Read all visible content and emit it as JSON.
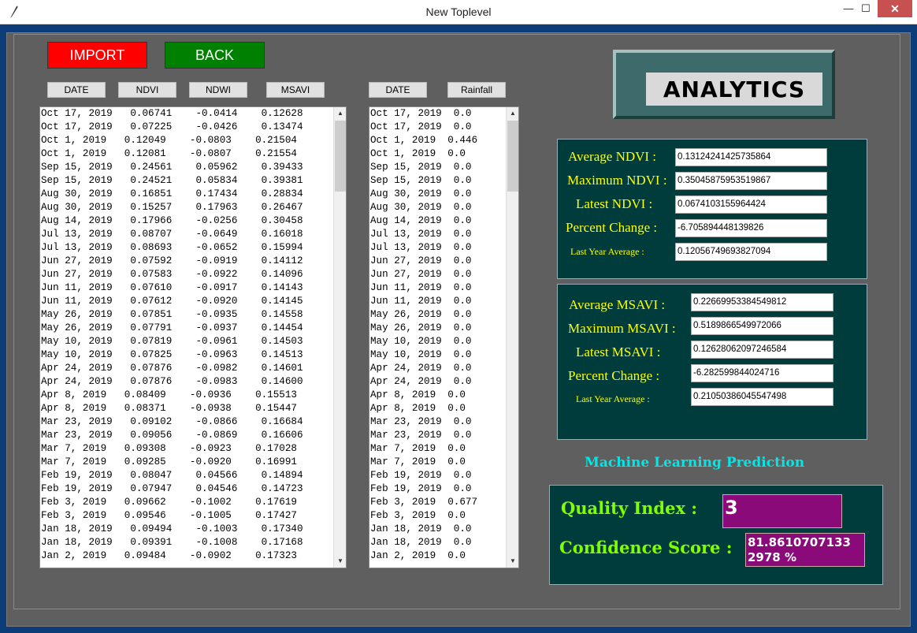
{
  "window": {
    "title": "New Toplevel",
    "minimize": "—",
    "maximize": "☐",
    "close": "✕"
  },
  "buttons": {
    "import": "IMPORT",
    "back": "BACK"
  },
  "headers": {
    "date1": "DATE",
    "ndvi": "NDVI",
    "ndwi": "NDWI",
    "msavi": "MSAVI",
    "date2": "DATE",
    "rainfall": "Rainfall"
  },
  "indices_rows": [
    "Oct 17, 2019   0.06741    -0.0414    0.12628",
    "Oct 17, 2019   0.07225    -0.0426    0.13474",
    "Oct 1, 2019   0.12049    -0.0803    0.21504",
    "Oct 1, 2019   0.12081    -0.0807    0.21554",
    "Sep 15, 2019   0.24561    0.05962    0.39433",
    "Sep 15, 2019   0.24521    0.05834    0.39381",
    "Aug 30, 2019   0.16851    0.17434    0.28834",
    "Aug 30, 2019   0.15257    0.17963    0.26467",
    "Aug 14, 2019   0.17966    -0.0256    0.30458",
    "Jul 13, 2019   0.08707    -0.0649    0.16018",
    "Jul 13, 2019   0.08693    -0.0652    0.15994",
    "Jun 27, 2019   0.07592    -0.0919    0.14112",
    "Jun 27, 2019   0.07583    -0.0922    0.14096",
    "Jun 11, 2019   0.07610    -0.0917    0.14143",
    "Jun 11, 2019   0.07612    -0.0920    0.14145",
    "May 26, 2019   0.07851    -0.0935    0.14558",
    "May 26, 2019   0.07791    -0.0937    0.14454",
    "May 10, 2019   0.07819    -0.0961    0.14503",
    "May 10, 2019   0.07825    -0.0963    0.14513",
    "Apr 24, 2019   0.07876    -0.0982    0.14601",
    "Apr 24, 2019   0.07876    -0.0983    0.14600",
    "Apr 8, 2019   0.08409    -0.0936    0.15513",
    "Apr 8, 2019   0.08371    -0.0938    0.15447",
    "Mar 23, 2019   0.09102    -0.0866    0.16684",
    "Mar 23, 2019   0.09056    -0.0869    0.16606",
    "Mar 7, 2019   0.09308    -0.0923    0.17028",
    "Mar 7, 2019   0.09285    -0.0920    0.16991",
    "Feb 19, 2019   0.08047    0.04566    0.14894",
    "Feb 19, 2019   0.07947    0.04546    0.14723",
    "Feb 3, 2019   0.09662    -0.1002    0.17619",
    "Feb 3, 2019   0.09546    -0.1005    0.17427",
    "Jan 18, 2019   0.09494    -0.1003    0.17340",
    "Jan 18, 2019   0.09391    -0.1008    0.17168",
    "Jan 2, 2019   0.09484    -0.0902    0.17323"
  ],
  "rainfall_rows": [
    "Oct 17, 2019  0.0",
    "Oct 17, 2019  0.0",
    "Oct 1, 2019  0.446",
    "Oct 1, 2019  0.0",
    "Sep 15, 2019  0.0",
    "Sep 15, 2019  0.0",
    "Aug 30, 2019  0.0",
    "Aug 30, 2019  0.0",
    "Aug 14, 2019  0.0",
    "Jul 13, 2019  0.0",
    "Jul 13, 2019  0.0",
    "Jun 27, 2019  0.0",
    "Jun 27, 2019  0.0",
    "Jun 11, 2019  0.0",
    "Jun 11, 2019  0.0",
    "May 26, 2019  0.0",
    "May 26, 2019  0.0",
    "May 10, 2019  0.0",
    "May 10, 2019  0.0",
    "Apr 24, 2019  0.0",
    "Apr 24, 2019  0.0",
    "Apr 8, 2019  0.0",
    "Apr 8, 2019  0.0",
    "Mar 23, 2019  0.0",
    "Mar 23, 2019  0.0",
    "Mar 7, 2019  0.0",
    "Mar 7, 2019  0.0",
    "Feb 19, 2019  0.0",
    "Feb 19, 2019  0.0",
    "Feb 3, 2019  0.677",
    "Feb 3, 2019  0.0",
    "Jan 18, 2019  0.0",
    "Jan 18, 2019  0.0",
    "Jan 2, 2019  0.0"
  ],
  "analytics": {
    "title": "ANALYTICS"
  },
  "ndvi_panel": {
    "average_label": "Average NDVI :",
    "average_value": "0.13124241425735864",
    "maximum_label": "Maximum NDVI :",
    "maximum_value": "0.35045875953519867",
    "latest_label": "Latest NDVI :",
    "latest_value": "0.0674103155964424",
    "percent_label": "Percent Change :",
    "percent_value": "-6.705894448139826",
    "lastyear_label": "Last Year Average :",
    "lastyear_value": "0.12056749693827094"
  },
  "msavi_panel": {
    "average_label": "Average MSAVI :",
    "average_value": "0.22669953384549812",
    "maximum_label": "Maximum MSAVI :",
    "maximum_value": "0.5189866549972066",
    "latest_label": "Latest MSAVI :",
    "latest_value": "0.12628062097246584",
    "percent_label": "Percent Change :",
    "percent_value": "-6.282599844024716",
    "lastyear_label": "Last Year Average :",
    "lastyear_value": "0.21050386045547498"
  },
  "prediction": {
    "title": "Machine Learning Prediction",
    "quality_label": "Quality Index :",
    "quality_value": "3",
    "confidence_label": "Confidence Score :",
    "confidence_line1": "81.8610707133",
    "confidence_line2": "2978 %"
  },
  "colors": {
    "import": "#ff0000",
    "back": "#008000",
    "panel": "#003c3c",
    "label": "#ffff00",
    "prediction_box": "#8b0a7a",
    "ml_title": "#00e8e8",
    "pred_label": "#7fff00"
  }
}
